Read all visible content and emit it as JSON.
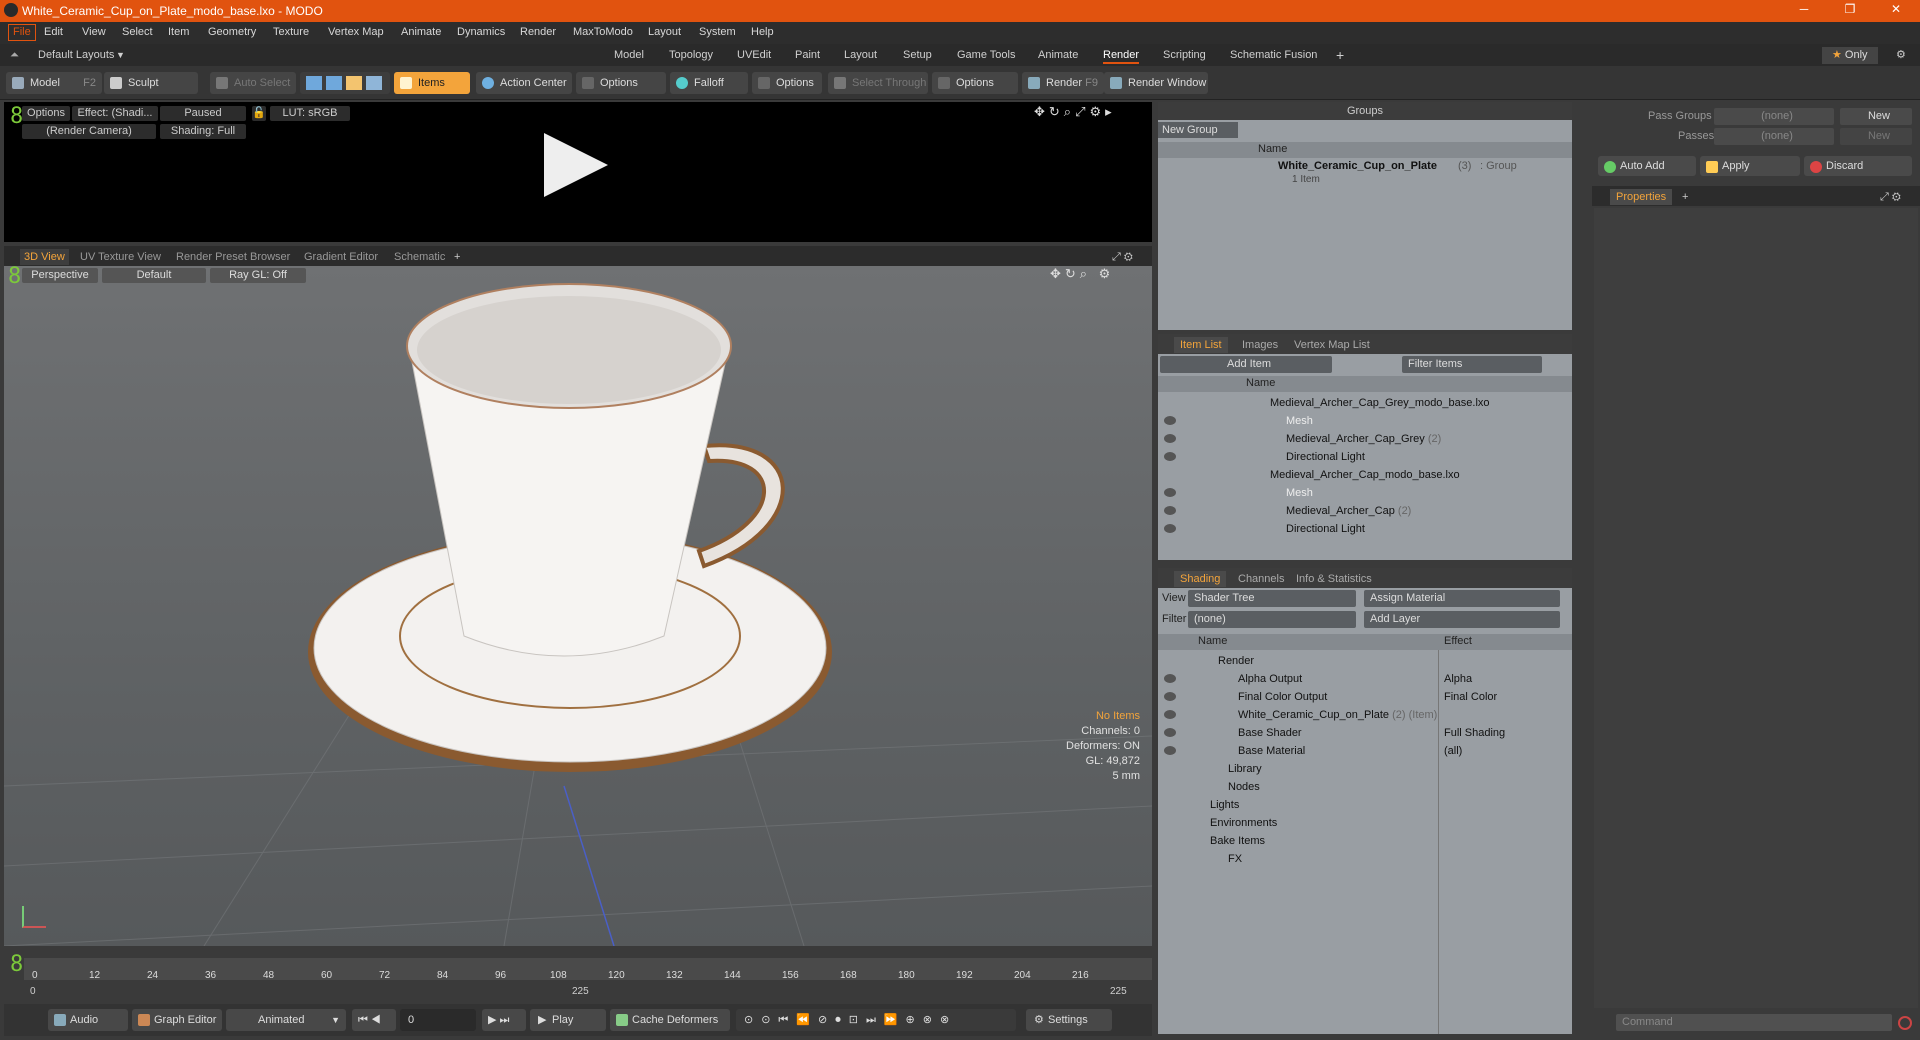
{
  "window": {
    "title": "White_Ceramic_Cup_on_Plate_modo_base.lxo - MODO"
  },
  "menu": [
    "File",
    "Edit",
    "View",
    "Select",
    "Item",
    "Geometry",
    "Texture",
    "Vertex Map",
    "Animate",
    "Dynamics",
    "Render",
    "MaxToModo",
    "Layout",
    "System",
    "Help"
  ],
  "layouts": {
    "label": "Default Layouts",
    "tabs": [
      "Model",
      "Topology",
      "UVEdit",
      "Paint",
      "Layout",
      "Setup",
      "Game Tools",
      "Animate",
      "Render",
      "Scripting",
      "Schematic Fusion"
    ],
    "active": "Render",
    "only": "Only"
  },
  "toolbar": {
    "model": "Model",
    "model_key": "F2",
    "sculpt": "Sculpt",
    "auto_select": "Auto Select",
    "items": "Items",
    "action_center": "Action Center",
    "options1": "Options",
    "falloff": "Falloff",
    "options2": "Options",
    "select_through": "Select Through",
    "options3": "Options",
    "render": "Render",
    "render_key": "F9",
    "render_window": "Render Window"
  },
  "render_view": {
    "options": "Options",
    "effect": "Effect: (Shadi...",
    "paused": "Paused",
    "lut": "LUT: sRGB",
    "camera": "(Render Camera)",
    "shading": "Shading: Full"
  },
  "view_tabs": [
    "3D View",
    "UV Texture View",
    "Render Preset Browser",
    "Gradient Editor",
    "Schematic"
  ],
  "view3d": {
    "projection": "Perspective",
    "style": "Default",
    "raygl": "Ray GL: Off",
    "hud": [
      "No Items",
      "Channels: 0",
      "Deformers: ON",
      "GL: 49,872",
      "5 mm"
    ]
  },
  "timeline": {
    "ticks": [
      "0",
      "12",
      "24",
      "36",
      "48",
      "60",
      "72",
      "84",
      "96",
      "108",
      "120",
      "132",
      "144",
      "156",
      "168",
      "180",
      "192",
      "204",
      "216"
    ],
    "start": "0",
    "mid": "225",
    "end": "225"
  },
  "bottom": {
    "audio": "Audio",
    "graph": "Graph Editor",
    "animated": "Animated",
    "frame": "0",
    "play": "Play",
    "cache": "Cache Deformers",
    "settings": "Settings"
  },
  "groups": {
    "title": "Groups",
    "new_group": "New Group",
    "name_col": "Name",
    "item": "White_Ceramic_Cup_on_Plate",
    "item_count": "(3)",
    "item_type": ": Group",
    "sub": "1 Item"
  },
  "item_list": {
    "tabs": [
      "Item List",
      "Images",
      "Vertex Map List"
    ],
    "add_item": "Add Item",
    "filter": "Filter Items",
    "name_col": "Name",
    "rows": [
      "Medieval_Archer_Cap_Grey_modo_base.lxo",
      "Mesh",
      "Medieval_Archer_Cap_Grey",
      "Directional Light",
      "Medieval_Archer_Cap_modo_base.lxo",
      "Mesh",
      "Medieval_Archer_Cap",
      "Directional Light"
    ],
    "count": "(2)"
  },
  "shading": {
    "tabs": [
      "Shading",
      "Channels",
      "Info & Statistics"
    ],
    "view_label": "View",
    "view_val": "Shader Tree",
    "assign": "Assign Material",
    "filter_label": "Filter",
    "filter_val": "(none)",
    "add_layer": "Add Layer",
    "name_col": "Name",
    "effect_col": "Effect",
    "rows": [
      "Render",
      "Alpha Output",
      "Final Color Output",
      "White_Ceramic_Cup_on_Plate",
      "Base Shader",
      "Base Material",
      "Library",
      "Nodes",
      "Lights",
      "Environments",
      "Bake Items",
      "FX"
    ],
    "effects": [
      "",
      "Alpha",
      "Final Color",
      "",
      "Full Shading",
      "(all)"
    ],
    "cup_suffix": "(2) (Item)"
  },
  "right": {
    "pass_groups": "Pass Groups",
    "passes": "Passes",
    "none": "(none)",
    "new": "New",
    "auto_add": "Auto Add",
    "apply": "Apply",
    "discard": "Discard",
    "properties": "Properties",
    "command": "Command"
  }
}
